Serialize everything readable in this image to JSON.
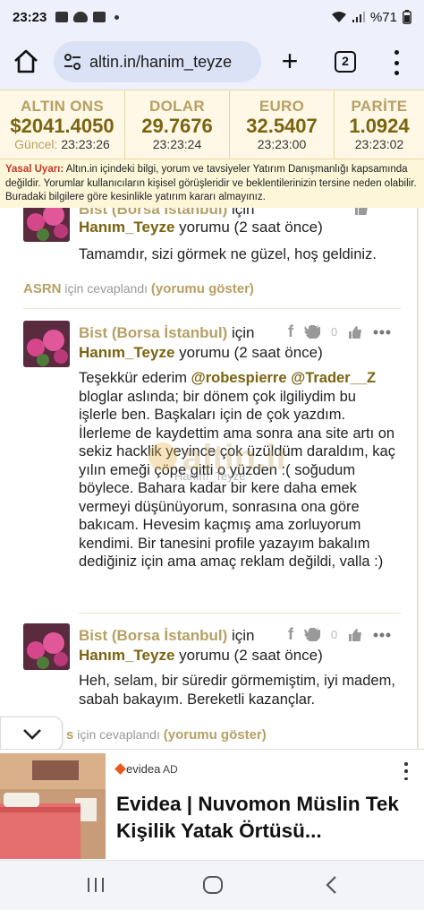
{
  "status_bar": {
    "time": "23:23",
    "battery": "%71"
  },
  "browser": {
    "url": "altin.in/hanim_teyze",
    "tab_count": "2"
  },
  "ticker": [
    {
      "name": "ALTIN ONS",
      "value": "$2041.4050",
      "time_label": "Güncel:",
      "time": "23:23:26"
    },
    {
      "name": "DOLAR",
      "value": "29.7676",
      "time": "23:23:24"
    },
    {
      "name": "EURO",
      "value": "32.5407",
      "time": "23:23:00"
    },
    {
      "name": "PARİTE",
      "value": "1.0924",
      "time": "23:23:02"
    }
  ],
  "disclaimer": {
    "label": "Yasal Uyarı:",
    "text": " Altın.in içindeki bilgi, yorum ve tavsiyeler Yatırım Danışmanlığı kapsamında değildir. Yorumlar kullanıcıların kişisel görüşleridir ve beklentilerinizin tersine neden olabilir. Buradaki bilgilere göre kesinlikle yatırım kararı almayınız."
  },
  "comments": [
    {
      "page": "Bist (Borsa İstanbul)",
      "for": " için",
      "user": "Hanım_Teyze",
      "meta": " yorumu (2 saat önce)",
      "body": "Tamamdır, sizi görmek ne güzel, hoş geldiniz.",
      "reply_user": "ASRN",
      "reply_text": " için cevaplandı ",
      "reply_show": "(yorumu göster)"
    },
    {
      "page": "Bist (Borsa İstanbul)",
      "for": " için",
      "user": "Hanım_Teyze",
      "meta": " yorumu (2 saat önce)",
      "like_count": "0",
      "body_pre": "Teşekkür ederim ",
      "mention1": "@robespierre",
      "mention2": "@Trader__Z",
      "body_post": " bloglar aslında; bir dönem çok ilgiliydim bu işlerle ben. Başkaları için de çok yazdım. İlerleme de kaydettim ama sonra ana site artı on sekiz hacklik yeyince çok üzüldüm daraldım, kaç yılın emeği çöpe gitti o yüzden :( soğudum böylece. Bahara kadar bir kere daha emek vermeyi düşünüyorum, sonrasına ona göre bakıcam. Hevesim kaçmış ama zorluyorum kendimi. Bir tanesini profile yazayım bakalım dediğiniz için ama amaç reklam değildi, valla :)"
    },
    {
      "page": "Bist (Borsa İstanbul)",
      "for": " için",
      "user": "Hanım_Teyze",
      "meta": " yorumu (2 saat önce)",
      "like_count": "0",
      "body": "Heh, selam, bir süredir görmemiştim, iyi madem, sabah bakayım. Bereketli kazançlar.",
      "reply_user": "s",
      "reply_text": " için cevaplandı ",
      "reply_show": "(yorumu göster)"
    }
  ],
  "watermark": {
    "brand": "altin.in",
    "user": "Hanım_Teyze"
  },
  "ad": {
    "brand": "evidea",
    "tag": "AD",
    "title": "Evidea | Nuvomon Müslin Tek Kişilik Yatak Örtüsü..."
  },
  "colors": {
    "gold": "#b6a064",
    "dark_gold": "#7a6410",
    "warn": "#c0392b"
  }
}
